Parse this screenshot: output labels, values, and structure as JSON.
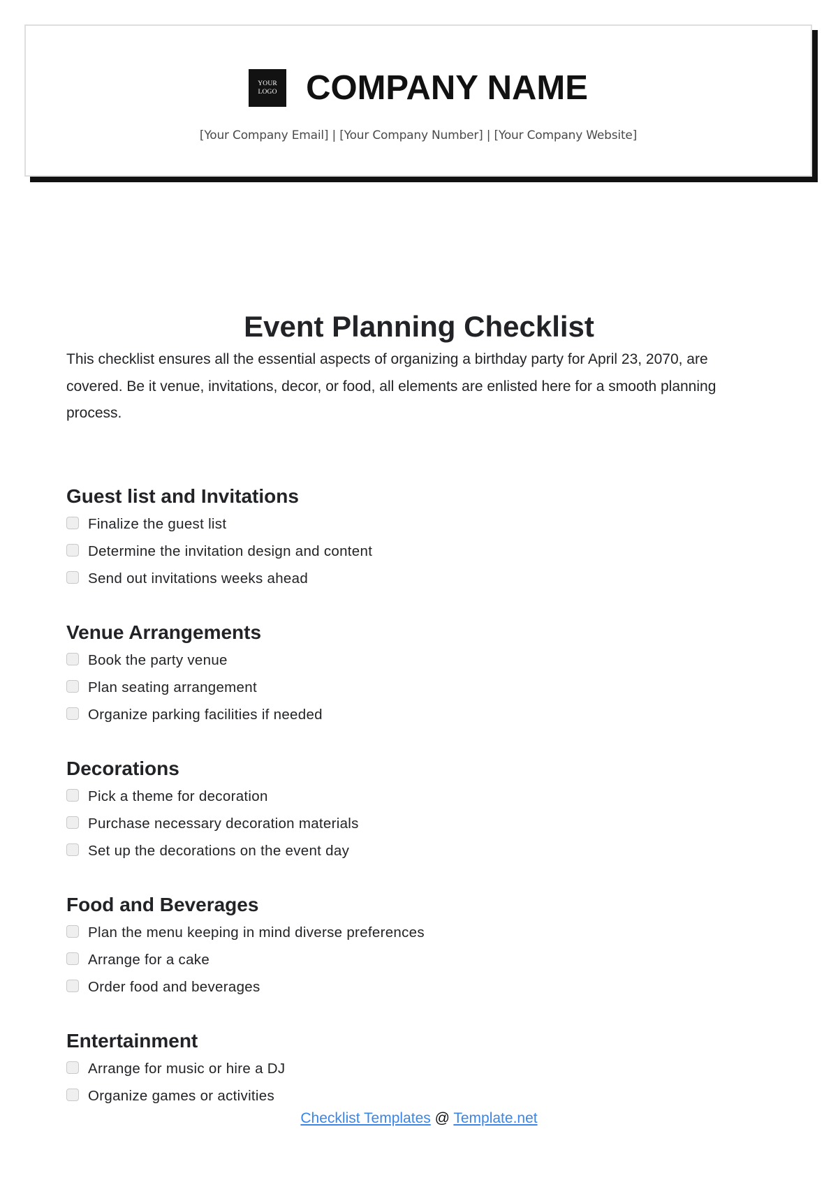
{
  "header": {
    "logo_line1": "YOUR",
    "logo_line2": "LOGO",
    "company_name": "COMPANY NAME",
    "contact_line": "[Your Company Email] | [Your Company Number] | [Your Company Website]"
  },
  "document": {
    "title": "Event Planning Checklist",
    "intro": "This checklist ensures all the essential aspects of organizing a birthday party for April 23, 2070, are covered. Be it venue, invitations, decor, or food, all elements are enlisted here for a smooth planning process."
  },
  "sections": [
    {
      "heading": "Guest list and Invitations",
      "items": [
        {
          "label": "Finalize the guest list",
          "checked": false
        },
        {
          "label": "Determine the invitation design and content",
          "checked": false
        },
        {
          "label": "Send out invitations weeks ahead",
          "checked": false
        }
      ]
    },
    {
      "heading": "Venue Arrangements",
      "items": [
        {
          "label": "Book the party venue",
          "checked": false
        },
        {
          "label": "Plan seating arrangement",
          "checked": false
        },
        {
          "label": "Organize parking facilities if needed",
          "checked": false
        }
      ]
    },
    {
      "heading": "Decorations",
      "items": [
        {
          "label": "Pick a theme for decoration",
          "checked": false
        },
        {
          "label": "Purchase necessary decoration materials",
          "checked": false
        },
        {
          "label": "Set up the decorations on the event day",
          "checked": false
        }
      ]
    },
    {
      "heading": "Food and Beverages",
      "items": [
        {
          "label": "Plan the menu keeping in mind diverse preferences",
          "checked": false
        },
        {
          "label": "Arrange for a cake",
          "checked": false
        },
        {
          "label": "Order food and beverages",
          "checked": false
        }
      ]
    },
    {
      "heading": "Entertainment",
      "items": [
        {
          "label": "Arrange for music or hire a DJ",
          "checked": false
        },
        {
          "label": "Organize games or activities",
          "checked": false
        }
      ]
    }
  ],
  "footer": {
    "link1_label": "Checklist Templates",
    "separator": " @ ",
    "link2_label": "Template.net",
    "link_color": "#3a86e8"
  }
}
